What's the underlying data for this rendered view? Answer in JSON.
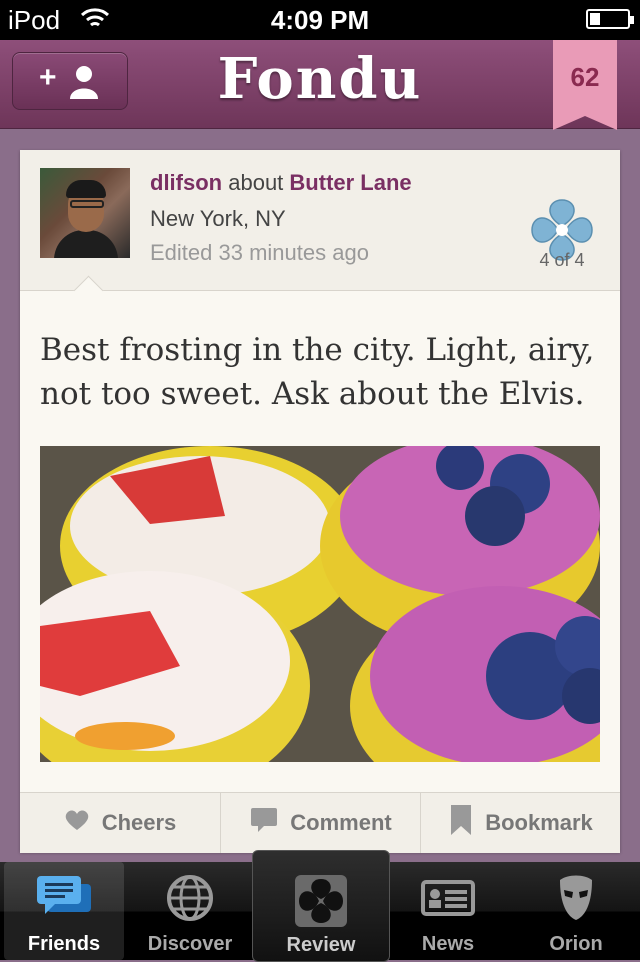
{
  "status_bar": {
    "carrier": "iPod",
    "time": "4:09 PM"
  },
  "nav": {
    "title": "Fondu",
    "badge_count": "62",
    "add_friend_plus": "+"
  },
  "post": {
    "username": "dlifson",
    "about_word": "about",
    "place": "Butter Lane",
    "location": "New York, NY",
    "edited": "Edited 33 minutes ago",
    "flower_count": "4 of 4",
    "text": "Best frosting in the city. Light, airy, not too sweet. Ask about the Elvis."
  },
  "actions": [
    {
      "label": "Cheers",
      "icon": "heart-icon"
    },
    {
      "label": "Comment",
      "icon": "comment-icon"
    },
    {
      "label": "Bookmark",
      "icon": "bookmark-icon"
    }
  ],
  "tabs": [
    {
      "label": "Friends",
      "icon": "chat-bubbles-icon"
    },
    {
      "label": "Discover",
      "icon": "globe-icon"
    },
    {
      "label": "Review",
      "icon": "fondu-flower-icon"
    },
    {
      "label": "News",
      "icon": "news-card-icon"
    },
    {
      "label": "Orion",
      "icon": "mask-icon"
    }
  ],
  "colors": {
    "brand": "#7a2f63",
    "badge": "#e99bb7",
    "background": "#8a6e8a"
  }
}
